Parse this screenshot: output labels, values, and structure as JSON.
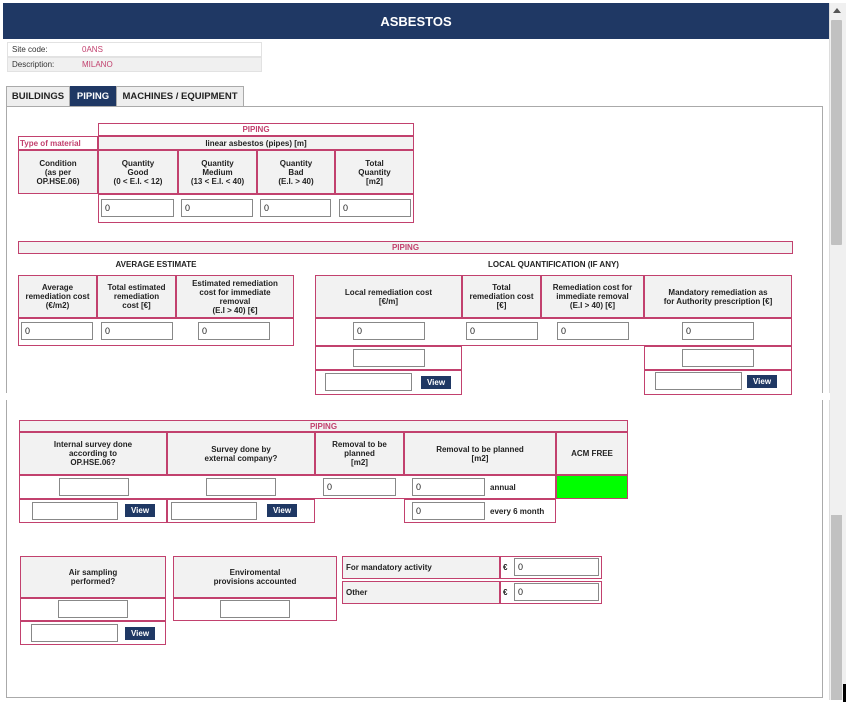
{
  "header": {
    "title": "ASBESTOS"
  },
  "info": {
    "site_code_label": "Site code:",
    "site_code_value": "0ANS",
    "description_label": "Description:",
    "description_value": "MILANO"
  },
  "tabs": [
    {
      "label": "BUILDINGS",
      "active": false
    },
    {
      "label": "PIPING",
      "active": true
    },
    {
      "label": "MACHINES / EQUIPMENT",
      "active": false
    }
  ],
  "section1": {
    "title": "PIPING",
    "type_of_material": "Type of material",
    "linear": "linear asbestos (pipes) [m]",
    "condition": "Condition\n(as per\nOP.HSE.06)",
    "qty_good": "Quantity\nGood\n(0 < E.I. < 12)",
    "qty_medium": "Quantity\nMedium\n(13 < E.I. < 40)",
    "qty_bad": "Quantity\nBad\n(E.I. > 40)",
    "total_qty": "Total\nQuantity\n[m2]",
    "values": [
      "0",
      "0",
      "0",
      "0"
    ]
  },
  "section2": {
    "title": "PIPING",
    "average_estimate": "AVERAGE ESTIMATE",
    "local_quant": "LOCAL QUANTIFICATION (IF ANY)",
    "avg_cost": "Average\nremediation cost\n(€/m2)",
    "total_est_cost": "Total estimated\nremediation\ncost [€]",
    "est_cost_immediate": "Estimated remediation\ncost for immediate\nremoval\n(E.I > 40) [€]",
    "local_cost": "Local remediation cost\n[€/m]",
    "total_rem_cost": "Total\nremediation cost\n[€]",
    "rem_cost_immediate": "Remediation cost for\nimmediate removal\n(E.I > 40) [€]",
    "mandatory_rem": "Mandatory remediation as\nfor Authority prescription [€]",
    "values_avg": [
      "0",
      "0",
      "0"
    ],
    "values_local": [
      "0",
      "0",
      "0",
      "0"
    ],
    "view_label": "View"
  },
  "section3": {
    "title": "PIPING",
    "internal_survey": "Internal survey done\naccording to\nOP.HSE.06?",
    "external_survey": "Survey done by\nexternal company?",
    "removal_planned": "Removal to be\nplanned\n[m2]",
    "removal_to_plan": "Removal to be planned\n[m2]",
    "acm_free": "ACM FREE",
    "acm_free_color": "#00ff00",
    "removal_value": "0",
    "annual_value": "0",
    "annual_label": "annual",
    "six_month_value": "0",
    "six_month_label": "every 6 month",
    "view_label": "View"
  },
  "section4": {
    "air_sampling": "Air sampling\nperformed?",
    "env_provisions": "Enviromental\nprovisions accounted",
    "mandatory_label": "For mandatory activity",
    "other_label": "Other",
    "currency": "€",
    "mandatory_value": "0",
    "other_value": "0",
    "view_label": "View"
  }
}
